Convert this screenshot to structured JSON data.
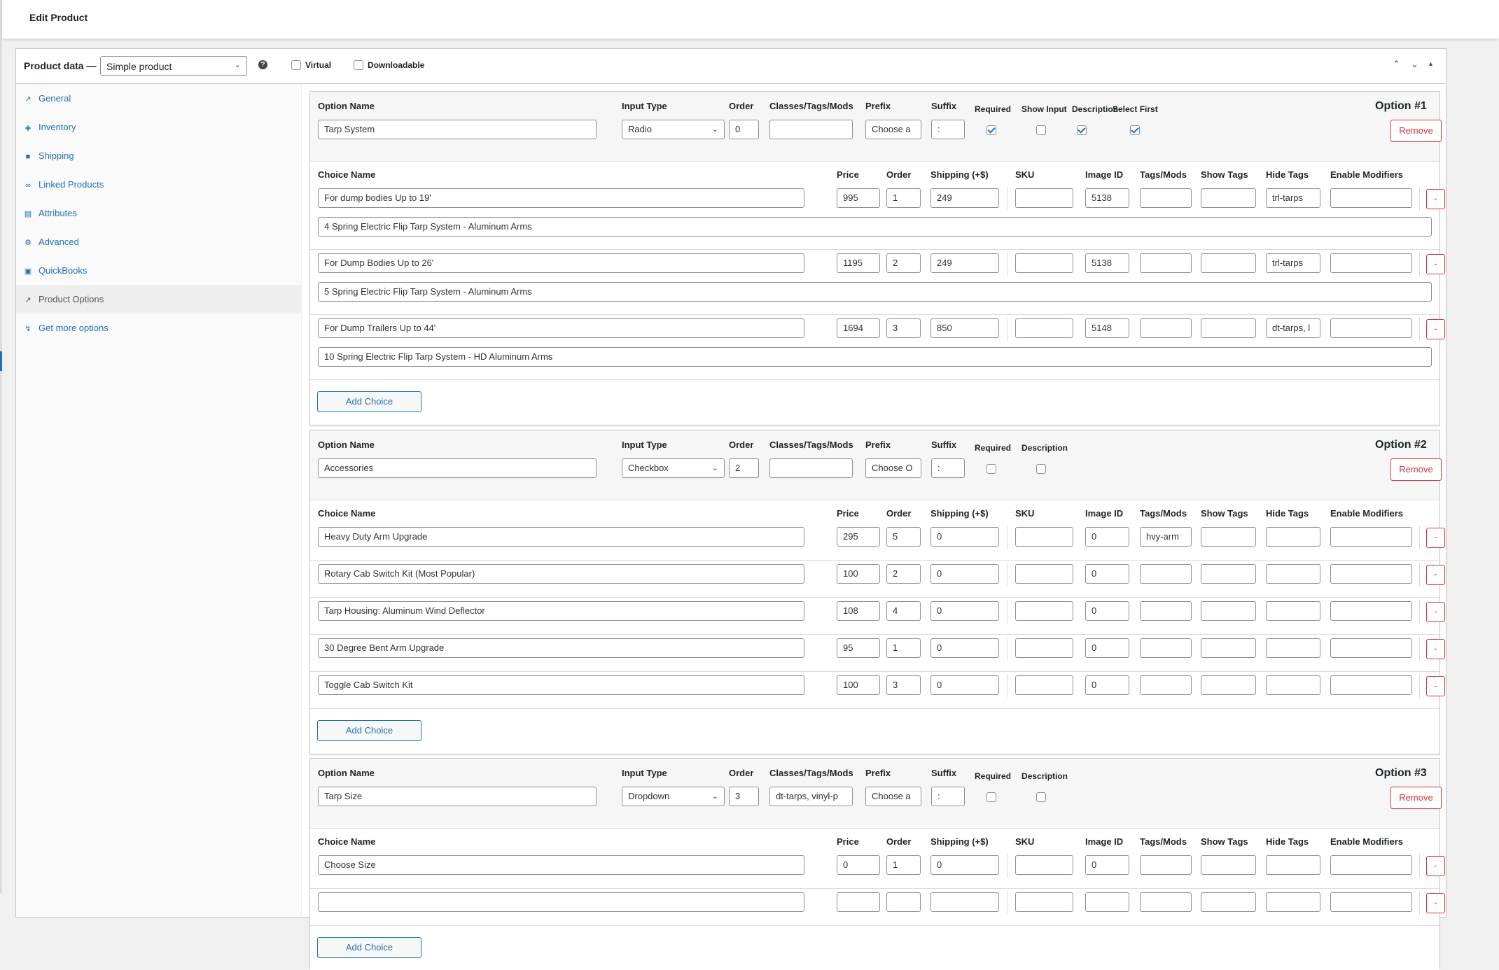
{
  "header": {
    "title": "Edit Product"
  },
  "product_data": {
    "label": "Product data —",
    "type": "Simple product",
    "help": "?",
    "virtual_label": "Virtual",
    "downloadable_label": "Downloadable",
    "controls": [
      "⌃",
      "⌄",
      "▴"
    ]
  },
  "nav": [
    {
      "label": "General",
      "icon": "wrench-icon",
      "glyph": "↗"
    },
    {
      "label": "Inventory",
      "icon": "tag-icon",
      "glyph": "◈"
    },
    {
      "label": "Shipping",
      "icon": "truck-icon",
      "glyph": "■"
    },
    {
      "label": "Linked Products",
      "icon": "link-icon",
      "glyph": "∞"
    },
    {
      "label": "Attributes",
      "icon": "table-icon",
      "glyph": "▤"
    },
    {
      "label": "Advanced",
      "icon": "gear-icon",
      "glyph": "⚙"
    },
    {
      "label": "QuickBooks",
      "icon": "quickbooks-icon",
      "glyph": "▣"
    },
    {
      "label": "Product Options",
      "icon": "wrench-icon",
      "glyph": "↗"
    },
    {
      "label": "Get more options",
      "icon": "plugin-icon",
      "glyph": "↯"
    }
  ],
  "labels": {
    "option_name": "Option Name",
    "input_type": "Input Type",
    "order": "Order",
    "classes": "Classes/Tags/Mods",
    "prefix": "Prefix",
    "suffix": "Suffix",
    "required": "Required",
    "show_input": "Show Input",
    "description": "Description",
    "select_first": "Select First",
    "remove": "Remove",
    "choice_name": "Choice Name",
    "price": "Price",
    "shipping": "Shipping (+$)",
    "sku": "SKU",
    "image_id": "Image ID",
    "tags_mods": "Tags/Mods",
    "show_tags": "Show Tags",
    "hide_tags": "Hide Tags",
    "enable_modifiers": "Enable Modifiers",
    "add_choice": "Add Choice",
    "minus": "-"
  },
  "options": [
    {
      "number": "Option #1",
      "name": "Tarp System",
      "input_type": "Radio",
      "order": "0",
      "classes": "",
      "prefix": "Choose a",
      "suffix": ":",
      "required": true,
      "show_input": false,
      "description": true,
      "select_first": true,
      "choices": [
        {
          "name": "For dump bodies Up to 19'",
          "price": "995",
          "order": "1",
          "shipping": "249",
          "sku": "",
          "image_id": "5138",
          "tags_mods": "",
          "show_tags": "",
          "hide_tags": "trl-tarps",
          "enable_modifiers": "",
          "description": "4 Spring Electric Flip Tarp System - Aluminum Arms"
        },
        {
          "name": "For Dump Bodies Up to 26'",
          "price": "1195",
          "order": "2",
          "shipping": "249",
          "sku": "",
          "image_id": "5138",
          "tags_mods": "",
          "show_tags": "",
          "hide_tags": "trl-tarps",
          "enable_modifiers": "",
          "description": "5 Spring Electric Flip Tarp System - Aluminum Arms"
        },
        {
          "name": "For Dump Trailers Up to 44'",
          "price": "1694",
          "order": "3",
          "shipping": "850",
          "sku": "",
          "image_id": "5148",
          "tags_mods": "",
          "show_tags": "",
          "hide_tags": "dt-tarps, l",
          "enable_modifiers": "",
          "description": "10 Spring Electric Flip Tarp System - HD Aluminum Arms"
        }
      ]
    },
    {
      "number": "Option #2",
      "name": "Accessories",
      "input_type": "Checkbox",
      "order": "2",
      "classes": "",
      "prefix": "Choose O",
      "suffix": ":",
      "required": false,
      "description": false,
      "choices": [
        {
          "name": "Heavy Duty Arm Upgrade",
          "price": "295",
          "order": "5",
          "shipping": "0",
          "sku": "",
          "image_id": "0",
          "tags_mods": "hvy-arm",
          "show_tags": "",
          "hide_tags": "",
          "enable_modifiers": ""
        },
        {
          "name": "Rotary Cab Switch Kit (Most Popular)",
          "price": "100",
          "order": "2",
          "shipping": "0",
          "sku": "",
          "image_id": "0",
          "tags_mods": "",
          "show_tags": "",
          "hide_tags": "",
          "enable_modifiers": ""
        },
        {
          "name": "Tarp Housing: Aluminum Wind Deflector",
          "price": "108",
          "order": "4",
          "shipping": "0",
          "sku": "",
          "image_id": "0",
          "tags_mods": "",
          "show_tags": "",
          "hide_tags": "",
          "enable_modifiers": ""
        },
        {
          "name": "30 Degree Bent Arm Upgrade",
          "price": "95",
          "order": "1",
          "shipping": "0",
          "sku": "",
          "image_id": "0",
          "tags_mods": "",
          "show_tags": "",
          "hide_tags": "",
          "enable_modifiers": ""
        },
        {
          "name": "Toggle Cab Switch Kit",
          "price": "100",
          "order": "3",
          "shipping": "0",
          "sku": "",
          "image_id": "0",
          "tags_mods": "",
          "show_tags": "",
          "hide_tags": "",
          "enable_modifiers": ""
        }
      ]
    },
    {
      "number": "Option #3",
      "name": "Tarp Size",
      "input_type": "Dropdown",
      "order": "3",
      "classes": "dt-tarps, vinyl-p",
      "prefix": "Choose a",
      "suffix": ":",
      "required": false,
      "description": false,
      "choices": [
        {
          "name": "Choose Size",
          "price": "0",
          "order": "1",
          "shipping": "0",
          "sku": "",
          "image_id": "0",
          "tags_mods": "",
          "show_tags": "",
          "hide_tags": "",
          "enable_modifiers": ""
        },
        {
          "name": "",
          "price": "",
          "order": "",
          "shipping": "",
          "sku": "",
          "image_id": "",
          "tags_mods": "",
          "show_tags": "",
          "hide_tags": "",
          "enable_modifiers": ""
        }
      ]
    }
  ],
  "colors": {
    "link": "#2271b1",
    "danger": "#d63638",
    "border": "#8c8f94"
  }
}
